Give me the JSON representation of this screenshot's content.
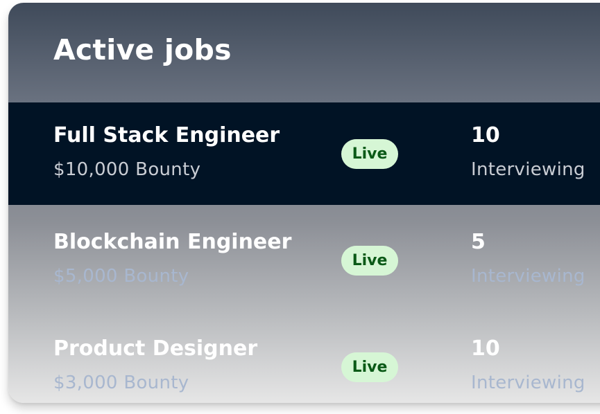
{
  "title": "Active jobs",
  "jobs": [
    {
      "title": "Full Stack Engineer",
      "bounty": "$10,000 Bounty",
      "status": "Live",
      "count": "10",
      "count_label": "Interviewing"
    },
    {
      "title": "Blockchain Engineer",
      "bounty": "$5,000 Bounty",
      "status": "Live",
      "count": "5",
      "count_label": "Interviewing"
    },
    {
      "title": "Product Designer",
      "bounty": "$3,000 Bounty",
      "status": "Live",
      "count": "10",
      "count_label": "Interviewing"
    }
  ],
  "colors": {
    "selected_row": "#011325",
    "badge_bg": "#d6f6d5",
    "badge_text": "#0b5a17"
  }
}
